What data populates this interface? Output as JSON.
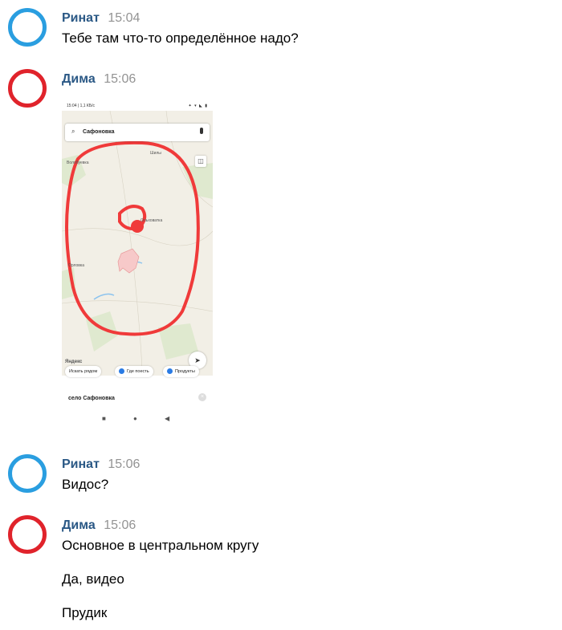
{
  "messages": [
    {
      "author": "Ринат",
      "time": "15:04",
      "avatar_color": "#2a9ee0",
      "lines": [
        "Тебе там что-то определённое надо?"
      ]
    },
    {
      "author": "Дима",
      "time": "15:06",
      "avatar_color": "#e0232b",
      "attachment": "map-screenshot"
    },
    {
      "author": "Ринат",
      "time": "15:06",
      "avatar_color": "#2a9ee0",
      "lines": [
        "Видос?"
      ]
    },
    {
      "author": "Дима",
      "time": "15:06",
      "avatar_color": "#e0232b",
      "lines": [
        "Основное в центральном кругу",
        "Да, видео",
        "Прудик"
      ]
    }
  ],
  "screenshot": {
    "status_time": "15:04 | 1,1 КБ/с",
    "status_icons": "✦ ▾ ◣ ▮",
    "search_query": "Сафоновка",
    "map_labels": [
      "Шилы",
      "Волобуевка",
      "Ольховатка",
      "Орловка"
    ],
    "map_brand": "Яндекс",
    "chips": [
      "Искать рядом",
      "Где поесть",
      "Продукты"
    ],
    "place_title": "село Сафоновка",
    "annotation_color": "#f03a3a"
  },
  "colors": {
    "name": "#2a5885",
    "time": "#939393"
  }
}
